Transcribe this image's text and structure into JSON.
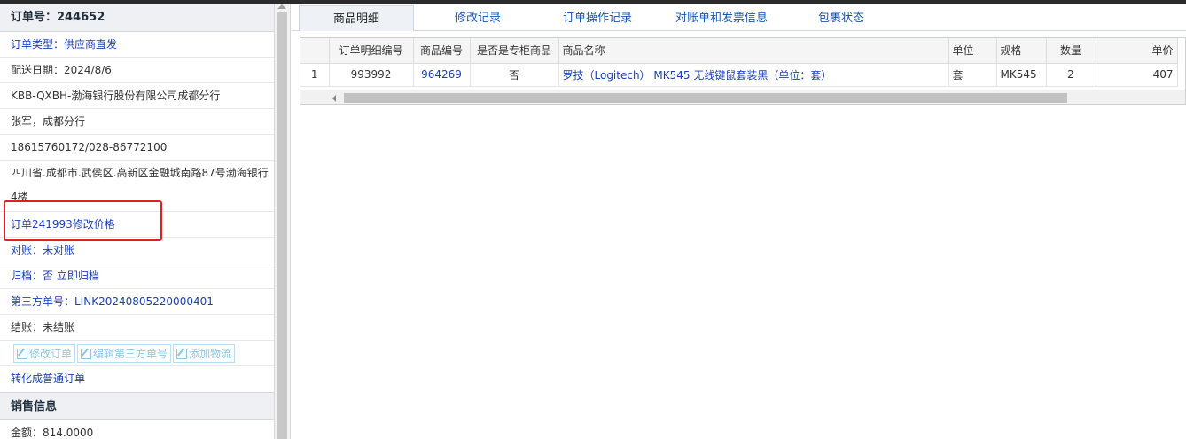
{
  "left": {
    "order_label": "订单号：244652",
    "rows": [
      "订单类型：供应商直发",
      "配送日期：2024/8/6",
      "KBB-QXBH-渤海银行股份有限公司成都分行",
      "张军，成都分行",
      "18615760172/028-86772100",
      "四川省.成都市.武侯区.高新区金融城南路87号渤海银行4楼",
      "订单241993修改价格",
      "对账：未对账",
      "归档：否 立即归档",
      "第三方单号：LINK20240805220000401",
      "结账：未结账"
    ],
    "buttons": [
      "修改订单",
      "编辑第三方单号",
      "添加物流"
    ],
    "convert_link": "转化成普通订单",
    "sales_header": "销售信息",
    "amount": "金额：814.0000"
  },
  "tabs": [
    "商品明细",
    "修改记录",
    "订单操作记录",
    "对账单和发票信息",
    "包裹状态"
  ],
  "table": {
    "headers": [
      "",
      "订单明细编号",
      "商品编号",
      "是否是专柜商品",
      "商品名称",
      "单位",
      "规格",
      "数量",
      "单价"
    ],
    "rows": [
      [
        "1",
        "993992",
        "964269",
        "否",
        "罗技（Logitech） MK545 无线键鼠套装黑（单位：套）",
        "套",
        "MK545",
        "2",
        "407"
      ]
    ]
  }
}
